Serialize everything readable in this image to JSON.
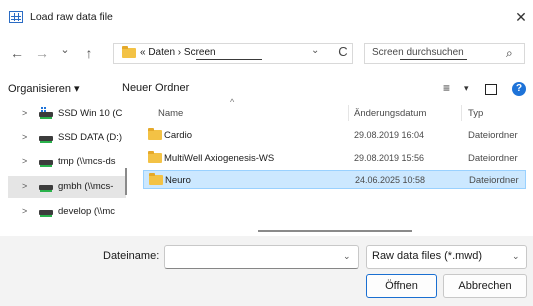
{
  "window": {
    "title": "Load raw data file",
    "close_glyph": "✕"
  },
  "nav": {
    "back_glyph": "←",
    "forward_glyph": "→",
    "recent_glyph": "⌄",
    "up_glyph": "↑",
    "address": "« Daten › Screen",
    "address_chevron": "⌄",
    "refresh_glyph": "C",
    "search_placeholder": "Screen durchsuchen",
    "search_glyph": "⌕"
  },
  "toolbar": {
    "organize_label": "Organisieren ▾",
    "new_folder_label": "Neuer Ordner",
    "view_glyph": "≡",
    "view_chevron": "▾",
    "help_glyph": "?"
  },
  "sidebar": {
    "items": [
      {
        "chevron": ">",
        "label": "SSD Win 10 (C",
        "icon": "windows-drive-icon"
      },
      {
        "chevron": ">",
        "label": "SSD DATA (D:)",
        "icon": "drive-icon"
      },
      {
        "chevron": ">",
        "label": "tmp (\\\\mcs-ds",
        "icon": "network-drive-icon"
      },
      {
        "chevron": ">",
        "label": "gmbh (\\\\mcs-",
        "icon": "network-drive-icon",
        "selected": true
      },
      {
        "chevron": ">",
        "label": "develop (\\\\mc",
        "icon": "network-drive-icon"
      }
    ]
  },
  "filelist": {
    "sort_caret": "^",
    "columns": {
      "name": "Name",
      "date": "Änderungsdatum",
      "type": "Typ"
    },
    "rows": [
      {
        "name": "Cardio",
        "date": "29.08.2019 16:04",
        "type": "Dateiordner",
        "selected": false
      },
      {
        "name": "MultiWell Axiogenesis-WS",
        "date": "29.08.2019 15:56",
        "type": "Dateiordner",
        "selected": false
      },
      {
        "name": "Neuro",
        "date": "24.06.2025 10:58",
        "type": "Dateiordner",
        "selected": true
      }
    ]
  },
  "footer": {
    "filename_label_prefix": "Dateiname:",
    "filename_value": "",
    "filename_chevron": "⌄",
    "filter_value": "Raw data files (*.mwd)",
    "filter_chevron": "⌄",
    "open_label": "Öffnen",
    "cancel_label": "Abbrechen"
  },
  "colors": {
    "accent": "#1a6fd1",
    "selection_bg": "#cce8ff",
    "selection_border": "#99d1ff",
    "folder": "#f3c245"
  }
}
